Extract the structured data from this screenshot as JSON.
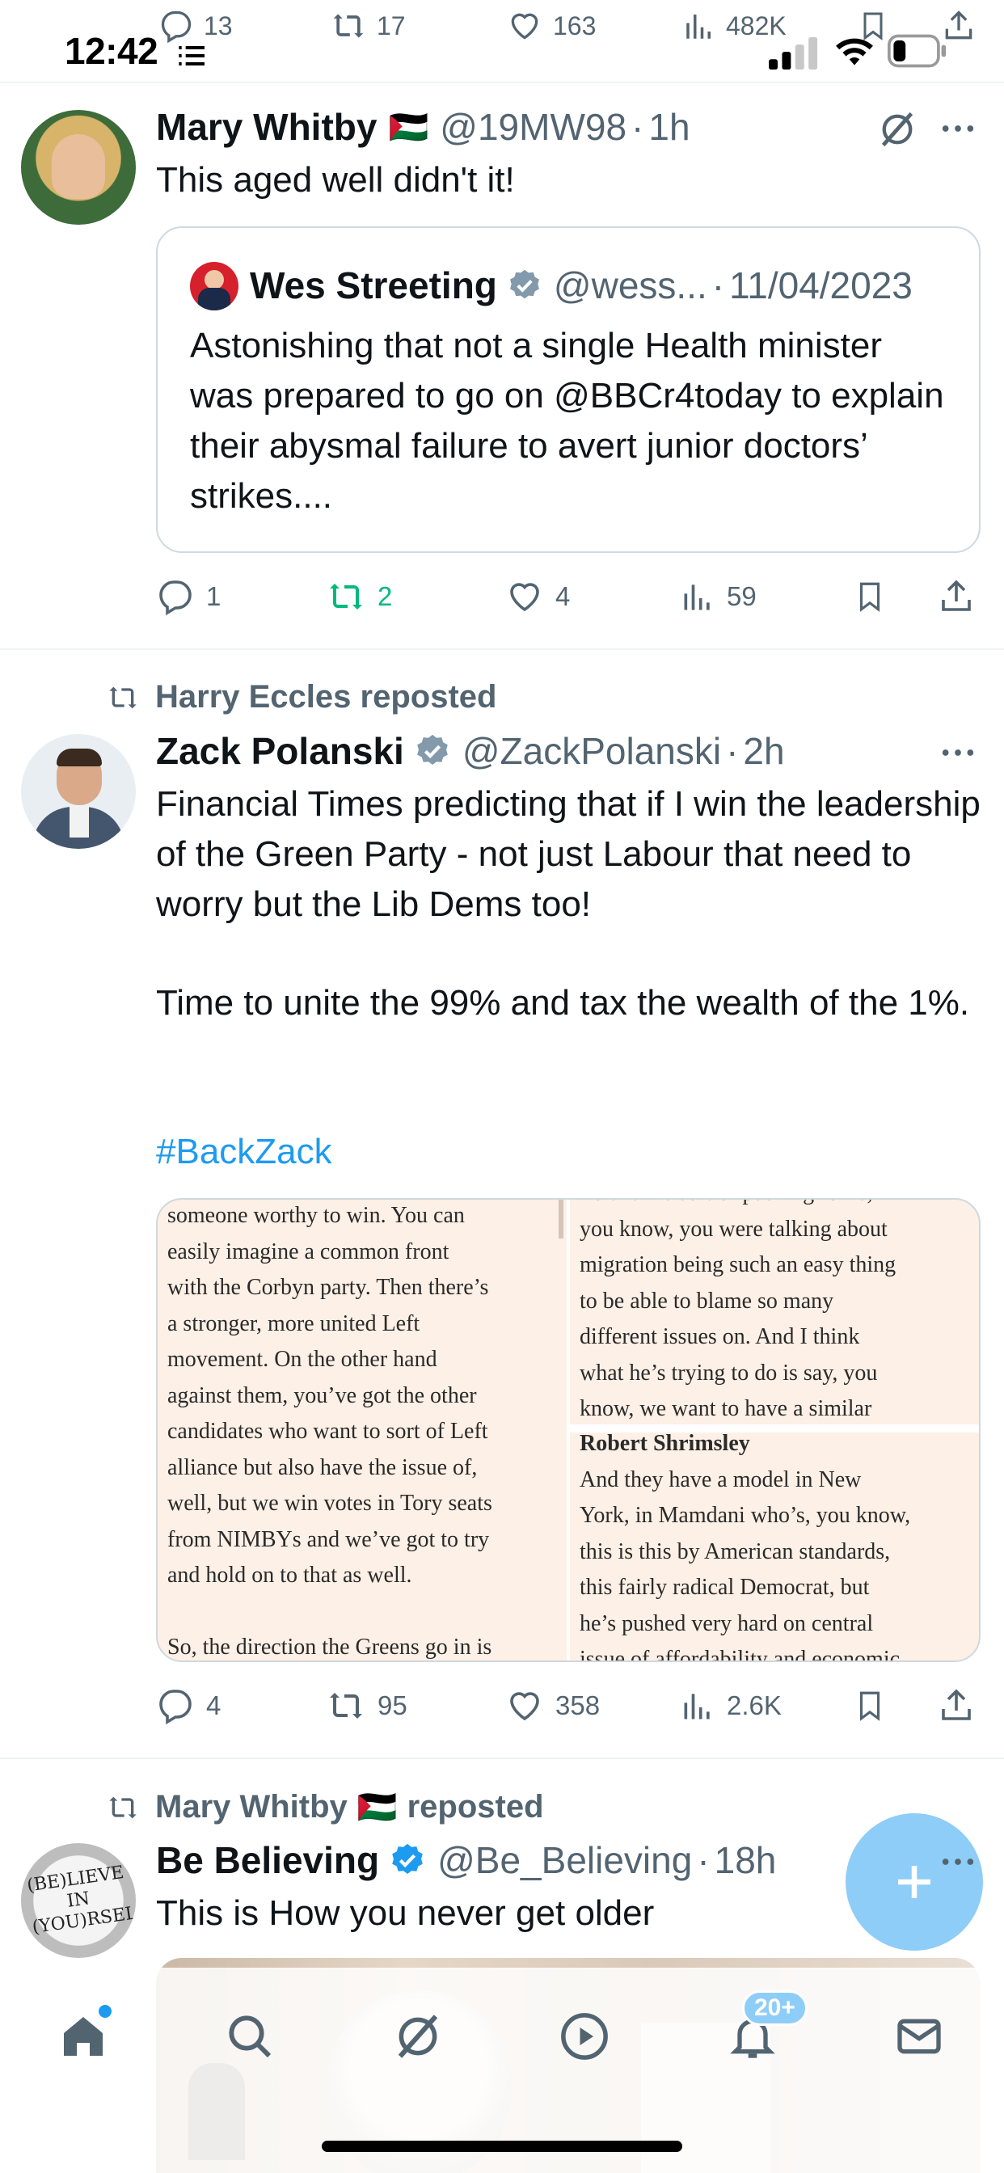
{
  "status_bar": {
    "time": "12:42"
  },
  "previous_tweet_actions": {
    "replies": "13",
    "reposts": "17",
    "likes": "163",
    "views": "482K"
  },
  "tweets": [
    {
      "author_name": "Mary Whitby",
      "flag_emoji": "🇵🇸",
      "handle": "@19MW98",
      "separator": "·",
      "time": "1h",
      "text": "This aged well didn't it!",
      "quote": {
        "author_name": "Wes Streeting",
        "handle": "@wess...",
        "separator": "·",
        "date": "11/04/2023",
        "text": "Astonishing that not a single Health minister was prepared to go on @BBCr4today to explain their abysmal failure to avert junior doctors’ strikes...."
      },
      "actions": {
        "replies": "1",
        "reposts": "2",
        "likes": "4",
        "views": "59"
      }
    },
    {
      "repost_context": "Harry Eccles reposted",
      "author_name": "Zack Polanski",
      "handle": "@ZackPolanski",
      "separator": "·",
      "time": "2h",
      "text_paragraph_1": "Financial Times predicting that if I win the leadership of the Green Party - not just Labour that need to worry but the Lib Dems too!",
      "text_paragraph_2": "Time to unite the 99% and tax the wealth of the 1%.",
      "hashtag": "#BackZack",
      "media_left_lines": [
        "someone worthy to win. You can",
        "easily imagine a common front",
        "with the Corbyn party. Then there’s",
        "a stronger, more united Left",
        "movement. On the other hand",
        "against them, you’ve got the other",
        "candidates who want to sort of Left",
        "alliance but also have the issue of,",
        "well, but we win votes in Tory seats",
        "from NIMBYs and we’ve got to try",
        "and hold on to that as well.",
        "",
        "So, the direction the Greens go in is"
      ],
      "media_right_top_lines": [
        "Polanski’s sort of pushing for is,",
        "you know, you were talking about",
        "migration being such an easy thing",
        "to be able to blame so many",
        "different issues on. And I think",
        "what he’s trying to do is say, you",
        "know, we want to have a similar"
      ],
      "media_right_speaker": "Robert Shrimsley",
      "media_right_bottom_lines": [
        "And they have a model in New",
        "York, in Mamdani who’s, you know,",
        "this is this by American standards,",
        "this fairly radical Democrat, but",
        "he’s pushed very hard on central",
        "issue of affordability and economic"
      ],
      "actions": {
        "replies": "4",
        "reposts": "95",
        "likes": "358",
        "views": "2.6K"
      }
    },
    {
      "repost_context_name": "Mary Whitby",
      "repost_context_flag": "🇵🇸",
      "repost_context_suffix": "reposted",
      "author_name": "Be Believing",
      "handle": "@Be_Believing",
      "separator": "·",
      "time": "18h",
      "text": "This is How you never get older",
      "avatar_text": "(BE)LIEVE IN (YOU)RSELF"
    }
  ],
  "notifications_badge": "20+",
  "colors": {
    "accent": "#1d9bf0",
    "repost_active": "#00ba7c",
    "muted": "#536471",
    "fab": "#8ecdf7",
    "media_bg": "#fdf0e6"
  },
  "icons": [
    "comment-icon",
    "repost-icon",
    "heart-icon",
    "views-icon",
    "bookmark-icon",
    "share-icon",
    "grok-icon",
    "more-icon",
    "verified-icon",
    "home-icon",
    "search-icon",
    "video-icon",
    "bell-icon",
    "mail-icon",
    "plus-icon",
    "wifi-icon",
    "signal-icon",
    "battery-icon"
  ]
}
